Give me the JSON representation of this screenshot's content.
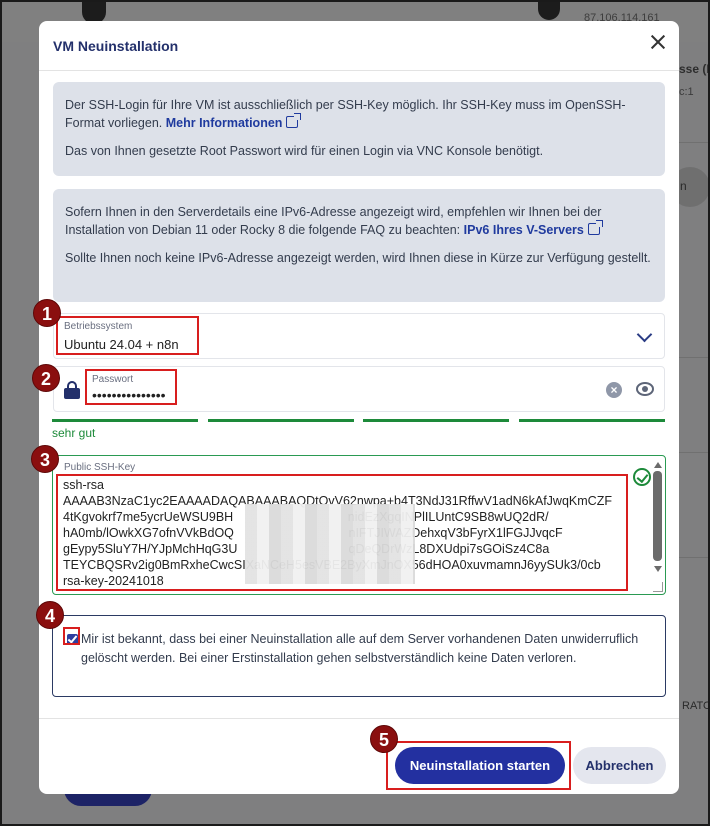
{
  "backdrop": {
    "ip_text": "87.106.114.161",
    "side_heading": "sse (IP",
    "side_sub": "c:1",
    "pill_text": "n",
    "rato_text": "RATO"
  },
  "modal": {
    "title": "VM Neuinstallation",
    "info1": {
      "p1_text": "Der SSH-Login für Ihre VM ist ausschließlich per SSH-Key möglich. Ihr SSH-Key muss im OpenSSH-Format vorliegen.",
      "p1_link": "Mehr Informationen",
      "p2_text": "Das von Ihnen gesetzte Root Passwort wird für einen Login via VNC Konsole benötigt."
    },
    "info2": {
      "p1_text": "Sofern Ihnen in den Serverdetails eine IPv6-Adresse angezeigt wird, empfehlen wir Ihnen bei der Installation von Debian 11 oder Rocky 8 die folgende FAQ zu beachten:",
      "p1_link": "IPv6 Ihres V-Servers",
      "p2_text": "Sollte Ihnen noch keine IPv6-Adresse angezeigt werden, wird Ihnen diese in Kürze zur Verfügung gestellt."
    },
    "os_field": {
      "label": "Betriebssystem",
      "value": "Ubuntu 24.04 + n8n"
    },
    "password_field": {
      "label": "Passwort",
      "value": "•••••••••••••••",
      "clear_glyph": "×"
    },
    "strength": {
      "level": 4,
      "max": 4,
      "text": "sehr gut"
    },
    "ssh_field": {
      "label": "Public SSH-Key",
      "lines": [
        "ssh-rsa",
        "AAAAB3NzaC1yc2EAAAADAQABAAABAQDtOvV62nwpa+b4T3NdJ31RffwV1adN6kAfJwqKmCZF",
        "4tKgvokrf7me5ycrUeWSU9BH                                 nidEzXgqINPlILUntC9SB8wUQ2dR/",
        "hA0mb/lOwkXG7ofnVVkBdOQ                                 nIFTJIWAZDehxqV3bFyrX1lFGJJvqcF",
        "gEypy5SluY7H/YJpMchHqG3U                                qDeQDrWzL8DXUdpi7sGOiSz4C8a",
        "TEYCBQSRv2ig0BmRxheCwcSIXaNCeH5esVBE2ByXmJnOX56dHOA0xuvmamnJ6yySUk3/0cb",
        "rsa-key-20241018"
      ]
    },
    "consent": {
      "checked": true,
      "text": "Mir ist bekannt, dass bei einer Neuinstallation alle auf dem Server vorhandenen Daten unwiderruflich gelöscht werden. Bei einer Erstinstallation gehen selbstverständlich keine Daten verloren."
    },
    "buttons": {
      "primary": "Neuinstallation starten",
      "secondary": "Abbrechen"
    }
  },
  "annotations": {
    "badges": [
      "1",
      "2",
      "3",
      "4",
      "5"
    ],
    "color": "#d81e1e"
  }
}
